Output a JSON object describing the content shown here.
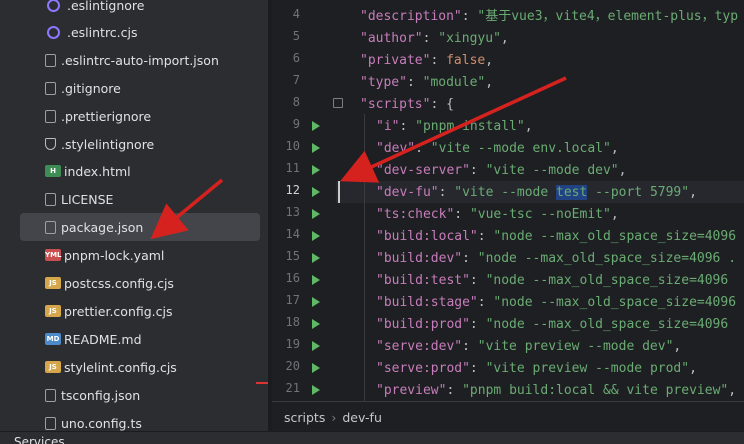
{
  "sidebar": {
    "items": [
      {
        "label": ".eslintignore",
        "icon": "eslint-icon"
      },
      {
        "label": ".eslintrc.cjs",
        "icon": "eslint-icon"
      },
      {
        "label": ".eslintrc-auto-import.json",
        "icon": "json-icon"
      },
      {
        "label": ".gitignore",
        "icon": "gitignore-icon"
      },
      {
        "label": ".prettierignore",
        "icon": "file-icon"
      },
      {
        "label": ".stylelintignore",
        "icon": "stylelint-icon"
      },
      {
        "label": "index.html",
        "icon": "html-icon"
      },
      {
        "label": "LICENSE",
        "icon": "file-icon"
      },
      {
        "label": "package.json",
        "icon": "json-icon"
      },
      {
        "label": "pnpm-lock.yaml",
        "icon": "yaml-icon"
      },
      {
        "label": "postcss.config.cjs",
        "icon": "js-icon"
      },
      {
        "label": "prettier.config.cjs",
        "icon": "js-icon"
      },
      {
        "label": "README.md",
        "icon": "markdown-icon"
      },
      {
        "label": "stylelint.config.cjs",
        "icon": "js-icon"
      },
      {
        "label": "tsconfig.json",
        "icon": "json-icon"
      },
      {
        "label": "uno.config.ts",
        "icon": "ts-icon"
      }
    ],
    "selected": "package.json"
  },
  "editor": {
    "line_numbers": [
      "4",
      "5",
      "6",
      "7",
      "8",
      "9",
      "10",
      "11",
      "12",
      "13",
      "14",
      "15",
      "16",
      "17",
      "18",
      "19",
      "20",
      "21"
    ],
    "lines": [
      {
        "key": "\"description\"",
        "sep": ": ",
        "val": "\"基于vue3，vite4，element-plus，typ",
        "end": ""
      },
      {
        "key": "\"author\"",
        "sep": ": ",
        "val": "\"xingyu\"",
        "end": ","
      },
      {
        "key": "\"private\"",
        "sep": ": ",
        "val": "false",
        "end": ","
      },
      {
        "key": "\"type\"",
        "sep": ": ",
        "val": "\"module\"",
        "end": ","
      },
      {
        "key": "\"scripts\"",
        "sep": ": ",
        "val": "{",
        "end": ""
      },
      {
        "key": "\"i\"",
        "sep": ": ",
        "val": "\"pnpm install\"",
        "end": ","
      },
      {
        "key": "\"dev\"",
        "sep": ": ",
        "val": "\"vite --mode env.local\"",
        "end": ","
      },
      {
        "key": "\"dev-server\"",
        "sep": ": ",
        "val": "\"vite --mode dev\"",
        "end": ","
      },
      {
        "key": "\"dev-fu\"",
        "sep": ": ",
        "val_a": "\"vite --mode ",
        "val_hl": "test",
        "val_b": " --port 5799\"",
        "end": ","
      },
      {
        "key": "\"ts:check\"",
        "sep": ": ",
        "val": "\"vue-tsc --noEmit\"",
        "end": ","
      },
      {
        "key": "\"build:local\"",
        "sep": ": ",
        "val": "\"node --max_old_space_size=4096",
        "end": ""
      },
      {
        "key": "\"build:dev\"",
        "sep": ": ",
        "val": "\"node --max_old_space_size=4096 .",
        "end": ""
      },
      {
        "key": "\"build:test\"",
        "sep": ": ",
        "val": "\"node --max_old_space_size=4096",
        "end": ""
      },
      {
        "key": "\"build:stage\"",
        "sep": ": ",
        "val": "\"node --max_old_space_size=4096",
        "end": ""
      },
      {
        "key": "\"build:prod\"",
        "sep": ": ",
        "val": "\"node --max_old_space_size=4096",
        "end": ""
      },
      {
        "key": "\"serve:dev\"",
        "sep": ": ",
        "val": "\"vite preview --mode dev\"",
        "end": ","
      },
      {
        "key": "\"serve:prod\"",
        "sep": ": ",
        "val": "\"vite preview --mode prod\"",
        "end": ","
      },
      {
        "key": "\"preview\"",
        "sep": ": ",
        "val": "\"pnpm build:local && vite preview\"",
        "end": ","
      }
    ],
    "current_line": "12"
  },
  "breadcrumb": {
    "part1": "scripts",
    "sep": "›",
    "part2": "dev-fu"
  },
  "bottom_bar": {
    "label": "Services"
  },
  "colors": {
    "accent": "#d6221f",
    "selection": "#43454a",
    "run": "#5fb865"
  }
}
